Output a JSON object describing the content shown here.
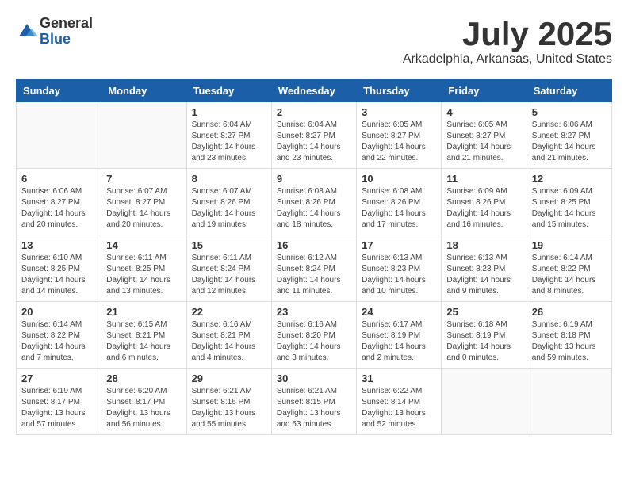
{
  "logo": {
    "general": "General",
    "blue": "Blue"
  },
  "title": "July 2025",
  "subtitle": "Arkadelphia, Arkansas, United States",
  "headers": [
    "Sunday",
    "Monday",
    "Tuesday",
    "Wednesday",
    "Thursday",
    "Friday",
    "Saturday"
  ],
  "weeks": [
    [
      {
        "day": "",
        "info": ""
      },
      {
        "day": "",
        "info": ""
      },
      {
        "day": "1",
        "info": "Sunrise: 6:04 AM\nSunset: 8:27 PM\nDaylight: 14 hours and 23 minutes."
      },
      {
        "day": "2",
        "info": "Sunrise: 6:04 AM\nSunset: 8:27 PM\nDaylight: 14 hours and 23 minutes."
      },
      {
        "day": "3",
        "info": "Sunrise: 6:05 AM\nSunset: 8:27 PM\nDaylight: 14 hours and 22 minutes."
      },
      {
        "day": "4",
        "info": "Sunrise: 6:05 AM\nSunset: 8:27 PM\nDaylight: 14 hours and 21 minutes."
      },
      {
        "day": "5",
        "info": "Sunrise: 6:06 AM\nSunset: 8:27 PM\nDaylight: 14 hours and 21 minutes."
      }
    ],
    [
      {
        "day": "6",
        "info": "Sunrise: 6:06 AM\nSunset: 8:27 PM\nDaylight: 14 hours and 20 minutes."
      },
      {
        "day": "7",
        "info": "Sunrise: 6:07 AM\nSunset: 8:27 PM\nDaylight: 14 hours and 20 minutes."
      },
      {
        "day": "8",
        "info": "Sunrise: 6:07 AM\nSunset: 8:26 PM\nDaylight: 14 hours and 19 minutes."
      },
      {
        "day": "9",
        "info": "Sunrise: 6:08 AM\nSunset: 8:26 PM\nDaylight: 14 hours and 18 minutes."
      },
      {
        "day": "10",
        "info": "Sunrise: 6:08 AM\nSunset: 8:26 PM\nDaylight: 14 hours and 17 minutes."
      },
      {
        "day": "11",
        "info": "Sunrise: 6:09 AM\nSunset: 8:26 PM\nDaylight: 14 hours and 16 minutes."
      },
      {
        "day": "12",
        "info": "Sunrise: 6:09 AM\nSunset: 8:25 PM\nDaylight: 14 hours and 15 minutes."
      }
    ],
    [
      {
        "day": "13",
        "info": "Sunrise: 6:10 AM\nSunset: 8:25 PM\nDaylight: 14 hours and 14 minutes."
      },
      {
        "day": "14",
        "info": "Sunrise: 6:11 AM\nSunset: 8:25 PM\nDaylight: 14 hours and 13 minutes."
      },
      {
        "day": "15",
        "info": "Sunrise: 6:11 AM\nSunset: 8:24 PM\nDaylight: 14 hours and 12 minutes."
      },
      {
        "day": "16",
        "info": "Sunrise: 6:12 AM\nSunset: 8:24 PM\nDaylight: 14 hours and 11 minutes."
      },
      {
        "day": "17",
        "info": "Sunrise: 6:13 AM\nSunset: 8:23 PM\nDaylight: 14 hours and 10 minutes."
      },
      {
        "day": "18",
        "info": "Sunrise: 6:13 AM\nSunset: 8:23 PM\nDaylight: 14 hours and 9 minutes."
      },
      {
        "day": "19",
        "info": "Sunrise: 6:14 AM\nSunset: 8:22 PM\nDaylight: 14 hours and 8 minutes."
      }
    ],
    [
      {
        "day": "20",
        "info": "Sunrise: 6:14 AM\nSunset: 8:22 PM\nDaylight: 14 hours and 7 minutes."
      },
      {
        "day": "21",
        "info": "Sunrise: 6:15 AM\nSunset: 8:21 PM\nDaylight: 14 hours and 6 minutes."
      },
      {
        "day": "22",
        "info": "Sunrise: 6:16 AM\nSunset: 8:21 PM\nDaylight: 14 hours and 4 minutes."
      },
      {
        "day": "23",
        "info": "Sunrise: 6:16 AM\nSunset: 8:20 PM\nDaylight: 14 hours and 3 minutes."
      },
      {
        "day": "24",
        "info": "Sunrise: 6:17 AM\nSunset: 8:19 PM\nDaylight: 14 hours and 2 minutes."
      },
      {
        "day": "25",
        "info": "Sunrise: 6:18 AM\nSunset: 8:19 PM\nDaylight: 14 hours and 0 minutes."
      },
      {
        "day": "26",
        "info": "Sunrise: 6:19 AM\nSunset: 8:18 PM\nDaylight: 13 hours and 59 minutes."
      }
    ],
    [
      {
        "day": "27",
        "info": "Sunrise: 6:19 AM\nSunset: 8:17 PM\nDaylight: 13 hours and 57 minutes."
      },
      {
        "day": "28",
        "info": "Sunrise: 6:20 AM\nSunset: 8:17 PM\nDaylight: 13 hours and 56 minutes."
      },
      {
        "day": "29",
        "info": "Sunrise: 6:21 AM\nSunset: 8:16 PM\nDaylight: 13 hours and 55 minutes."
      },
      {
        "day": "30",
        "info": "Sunrise: 6:21 AM\nSunset: 8:15 PM\nDaylight: 13 hours and 53 minutes."
      },
      {
        "day": "31",
        "info": "Sunrise: 6:22 AM\nSunset: 8:14 PM\nDaylight: 13 hours and 52 minutes."
      },
      {
        "day": "",
        "info": ""
      },
      {
        "day": "",
        "info": ""
      }
    ]
  ]
}
